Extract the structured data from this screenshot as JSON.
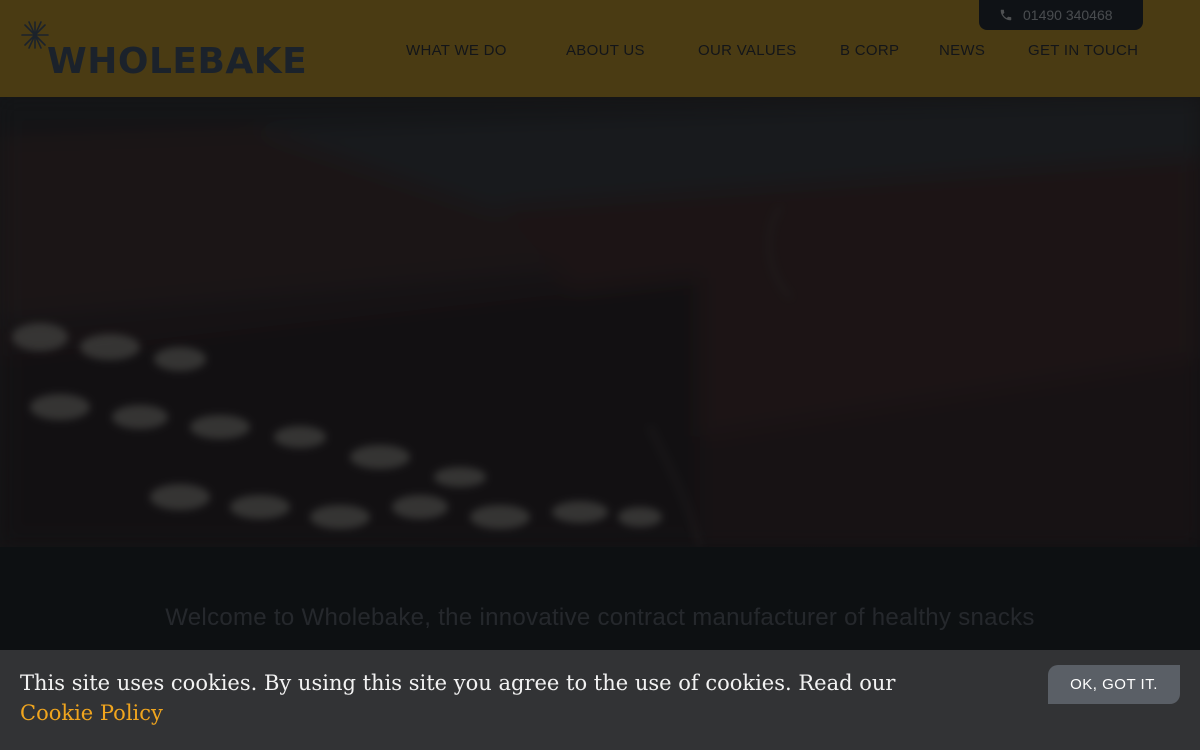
{
  "header": {
    "phone": "01490 340468",
    "logo_text": "WHOLEBAKE",
    "nav": [
      "WHAT WE DO",
      "ABOUT US",
      "OUR VALUES",
      "B CORP",
      "NEWS",
      "GET IN TOUCH"
    ]
  },
  "hero": {
    "image": "blurred-snack-bars-photo"
  },
  "welcome": {
    "text": "Welcome to Wholebake, the innovative contract manufacturer of healthy snacks"
  },
  "cookie_bar": {
    "message": "This site uses cookies. By using this site you agree to the use of cookies. Read our ",
    "link_text": "Cookie Policy",
    "button_label": "OK, GOT IT."
  },
  "colors": {
    "header_bg": "#f0b41e",
    "accent": "#f0a51e",
    "logo": "#4a5a75",
    "phone_tab": "#1e222a"
  }
}
